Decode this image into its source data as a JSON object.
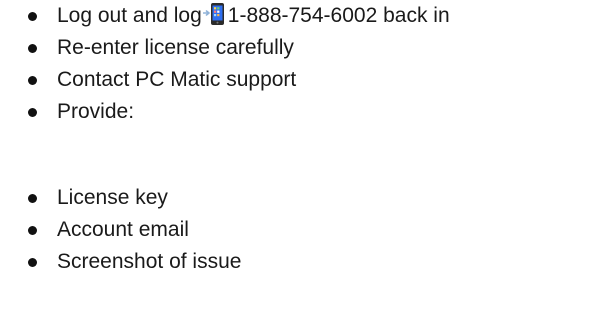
{
  "group1": {
    "items": [
      {
        "before": "Log out and log",
        "phone_icon": "mobile-phone-with-arrow-icon",
        "after": "1-888-754-6002 back in"
      },
      {
        "text": "Re-enter license carefully"
      },
      {
        "text": "Contact PC Matic support"
      },
      {
        "text": "Provide:"
      }
    ]
  },
  "group2": {
    "items": [
      {
        "text": "License key"
      },
      {
        "text": "Account email"
      },
      {
        "text": "Screenshot of issue"
      }
    ]
  }
}
